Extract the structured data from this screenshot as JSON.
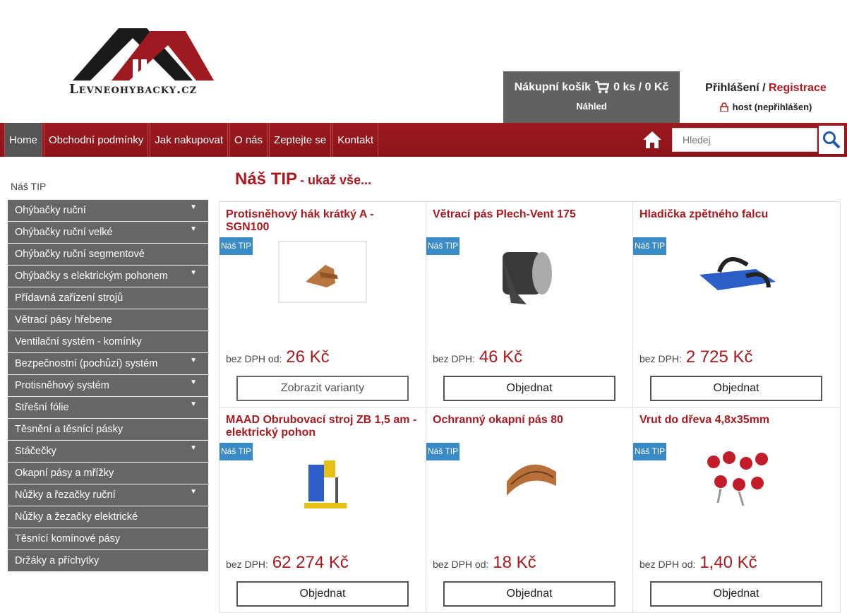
{
  "header": {
    "logo_text": "Levneohybacky.cz",
    "cart": {
      "label": "Nákupní košík",
      "amount": "0 ks / 0 Kč",
      "preview": "Náhled"
    },
    "login": {
      "login_label": "Přihlášení",
      "separator": " / ",
      "register_label": "Registrace",
      "user": "host (nepřihlášen)"
    }
  },
  "nav": {
    "items": [
      "Home",
      "Obchodní podmínky",
      "Jak nakupovat",
      "O nás",
      "Zeptejte se",
      "Kontakt"
    ],
    "search_placeholder": "Hledej"
  },
  "sidebar": {
    "title": "Náš TIP",
    "items": [
      {
        "label": "Ohýbačky ruční",
        "has_sub": true
      },
      {
        "label": "Ohýbačky ruční velké",
        "has_sub": true
      },
      {
        "label": "Ohýbačky ruční segmentové",
        "has_sub": false
      },
      {
        "label": "Ohýbačky s elektrickým pohonem",
        "has_sub": true
      },
      {
        "label": "Přídavná zařízení strojů",
        "has_sub": false
      },
      {
        "label": "Větrací pásy hřebene",
        "has_sub": false
      },
      {
        "label": "Ventilační systém - komínky",
        "has_sub": false
      },
      {
        "label": "Bezpečnostní (pochůzí) systém",
        "has_sub": true
      },
      {
        "label": "Protisněhový systém",
        "has_sub": true
      },
      {
        "label": "Střešní fólie",
        "has_sub": true
      },
      {
        "label": "Těsnění a těsnící pásky",
        "has_sub": false
      },
      {
        "label": "Stáčečky",
        "has_sub": true
      },
      {
        "label": "Okapní pásy a mřížky",
        "has_sub": false
      },
      {
        "label": "Nůžky a řezačky ruční",
        "has_sub": true
      },
      {
        "label": "Nůžky a žezačky elektrické",
        "has_sub": false
      },
      {
        "label": "Těsnící komínové pásy",
        "has_sub": false
      },
      {
        "label": "Držáky a příchytky",
        "has_sub": false
      }
    ]
  },
  "main": {
    "title": "Náš TIP",
    "subtitle": "- ukaž vše...",
    "tip_badge": "Náš TIP",
    "products": [
      {
        "title": "Protisněhový hák krátký A - SGN100",
        "price_label": "bez DPH od:",
        "price": "26 Kč",
        "button": "Zobrazit varianty",
        "icon": "snow-hook-image"
      },
      {
        "title": "Větrací pás Plech-Vent 175",
        "price_label": "bez DPH:",
        "price": "46 Kč",
        "button": "Objednat",
        "icon": "vent-roll-image"
      },
      {
        "title": "Hladička zpětného falcu",
        "price_label": "bez DPH:",
        "price": "2 725 Kč",
        "button": "Objednat",
        "icon": "seamer-tool-image"
      },
      {
        "title": "MAAD Obrubovací stroj ZB 1,5 am - elektrický pohon",
        "price_label": "bez DPH:",
        "price": "62 274 Kč",
        "button": "Objednat",
        "icon": "flanging-machine-image"
      },
      {
        "title": "Ochranný okapní pás 80",
        "price_label": "bez DPH od:",
        "price": "18 Kč",
        "button": "Objednat",
        "icon": "gutter-mesh-image"
      },
      {
        "title": "Vrut do dřeva 4,8x35mm",
        "price_label": "bez DPH od:",
        "price": "1,40 Kč",
        "button": "Objednat",
        "icon": "screws-image"
      }
    ]
  }
}
